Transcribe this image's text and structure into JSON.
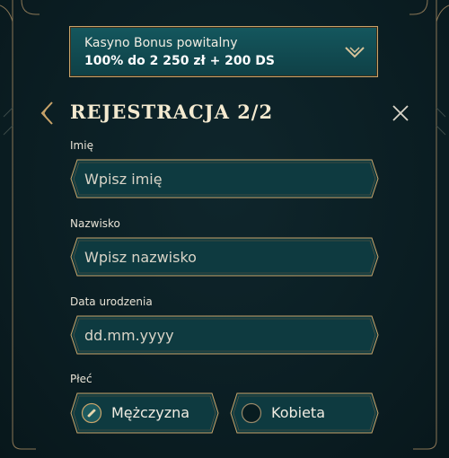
{
  "bonus": {
    "line1": "Kasyno Bonus powitalny",
    "line2": "100% do 2 250 zł + 200 DS"
  },
  "header": {
    "title": "Rejestracja 2/2"
  },
  "form": {
    "first_name": {
      "label": "Imię",
      "placeholder": "Wpisz imię",
      "value": ""
    },
    "last_name": {
      "label": "Nazwisko",
      "placeholder": "Wpisz nazwisko",
      "value": ""
    },
    "birth_date": {
      "label": "Data urodzenia",
      "placeholder": "dd.mm.yyyy",
      "value": ""
    },
    "gender": {
      "label": "Płeć",
      "options": [
        {
          "label": "Mężczyzna",
          "selected": true
        },
        {
          "label": "Kobieta",
          "selected": false
        }
      ]
    }
  },
  "colors": {
    "background": "#0a1d22",
    "field_fill": "#0e3a40",
    "gold_border": "#c9a46a",
    "bonus_fill": "#14575e"
  },
  "icons": [
    "chevron-down-icon",
    "back-arrow-icon",
    "close-icon",
    "radio-checked-icon",
    "radio-unchecked-icon"
  ]
}
